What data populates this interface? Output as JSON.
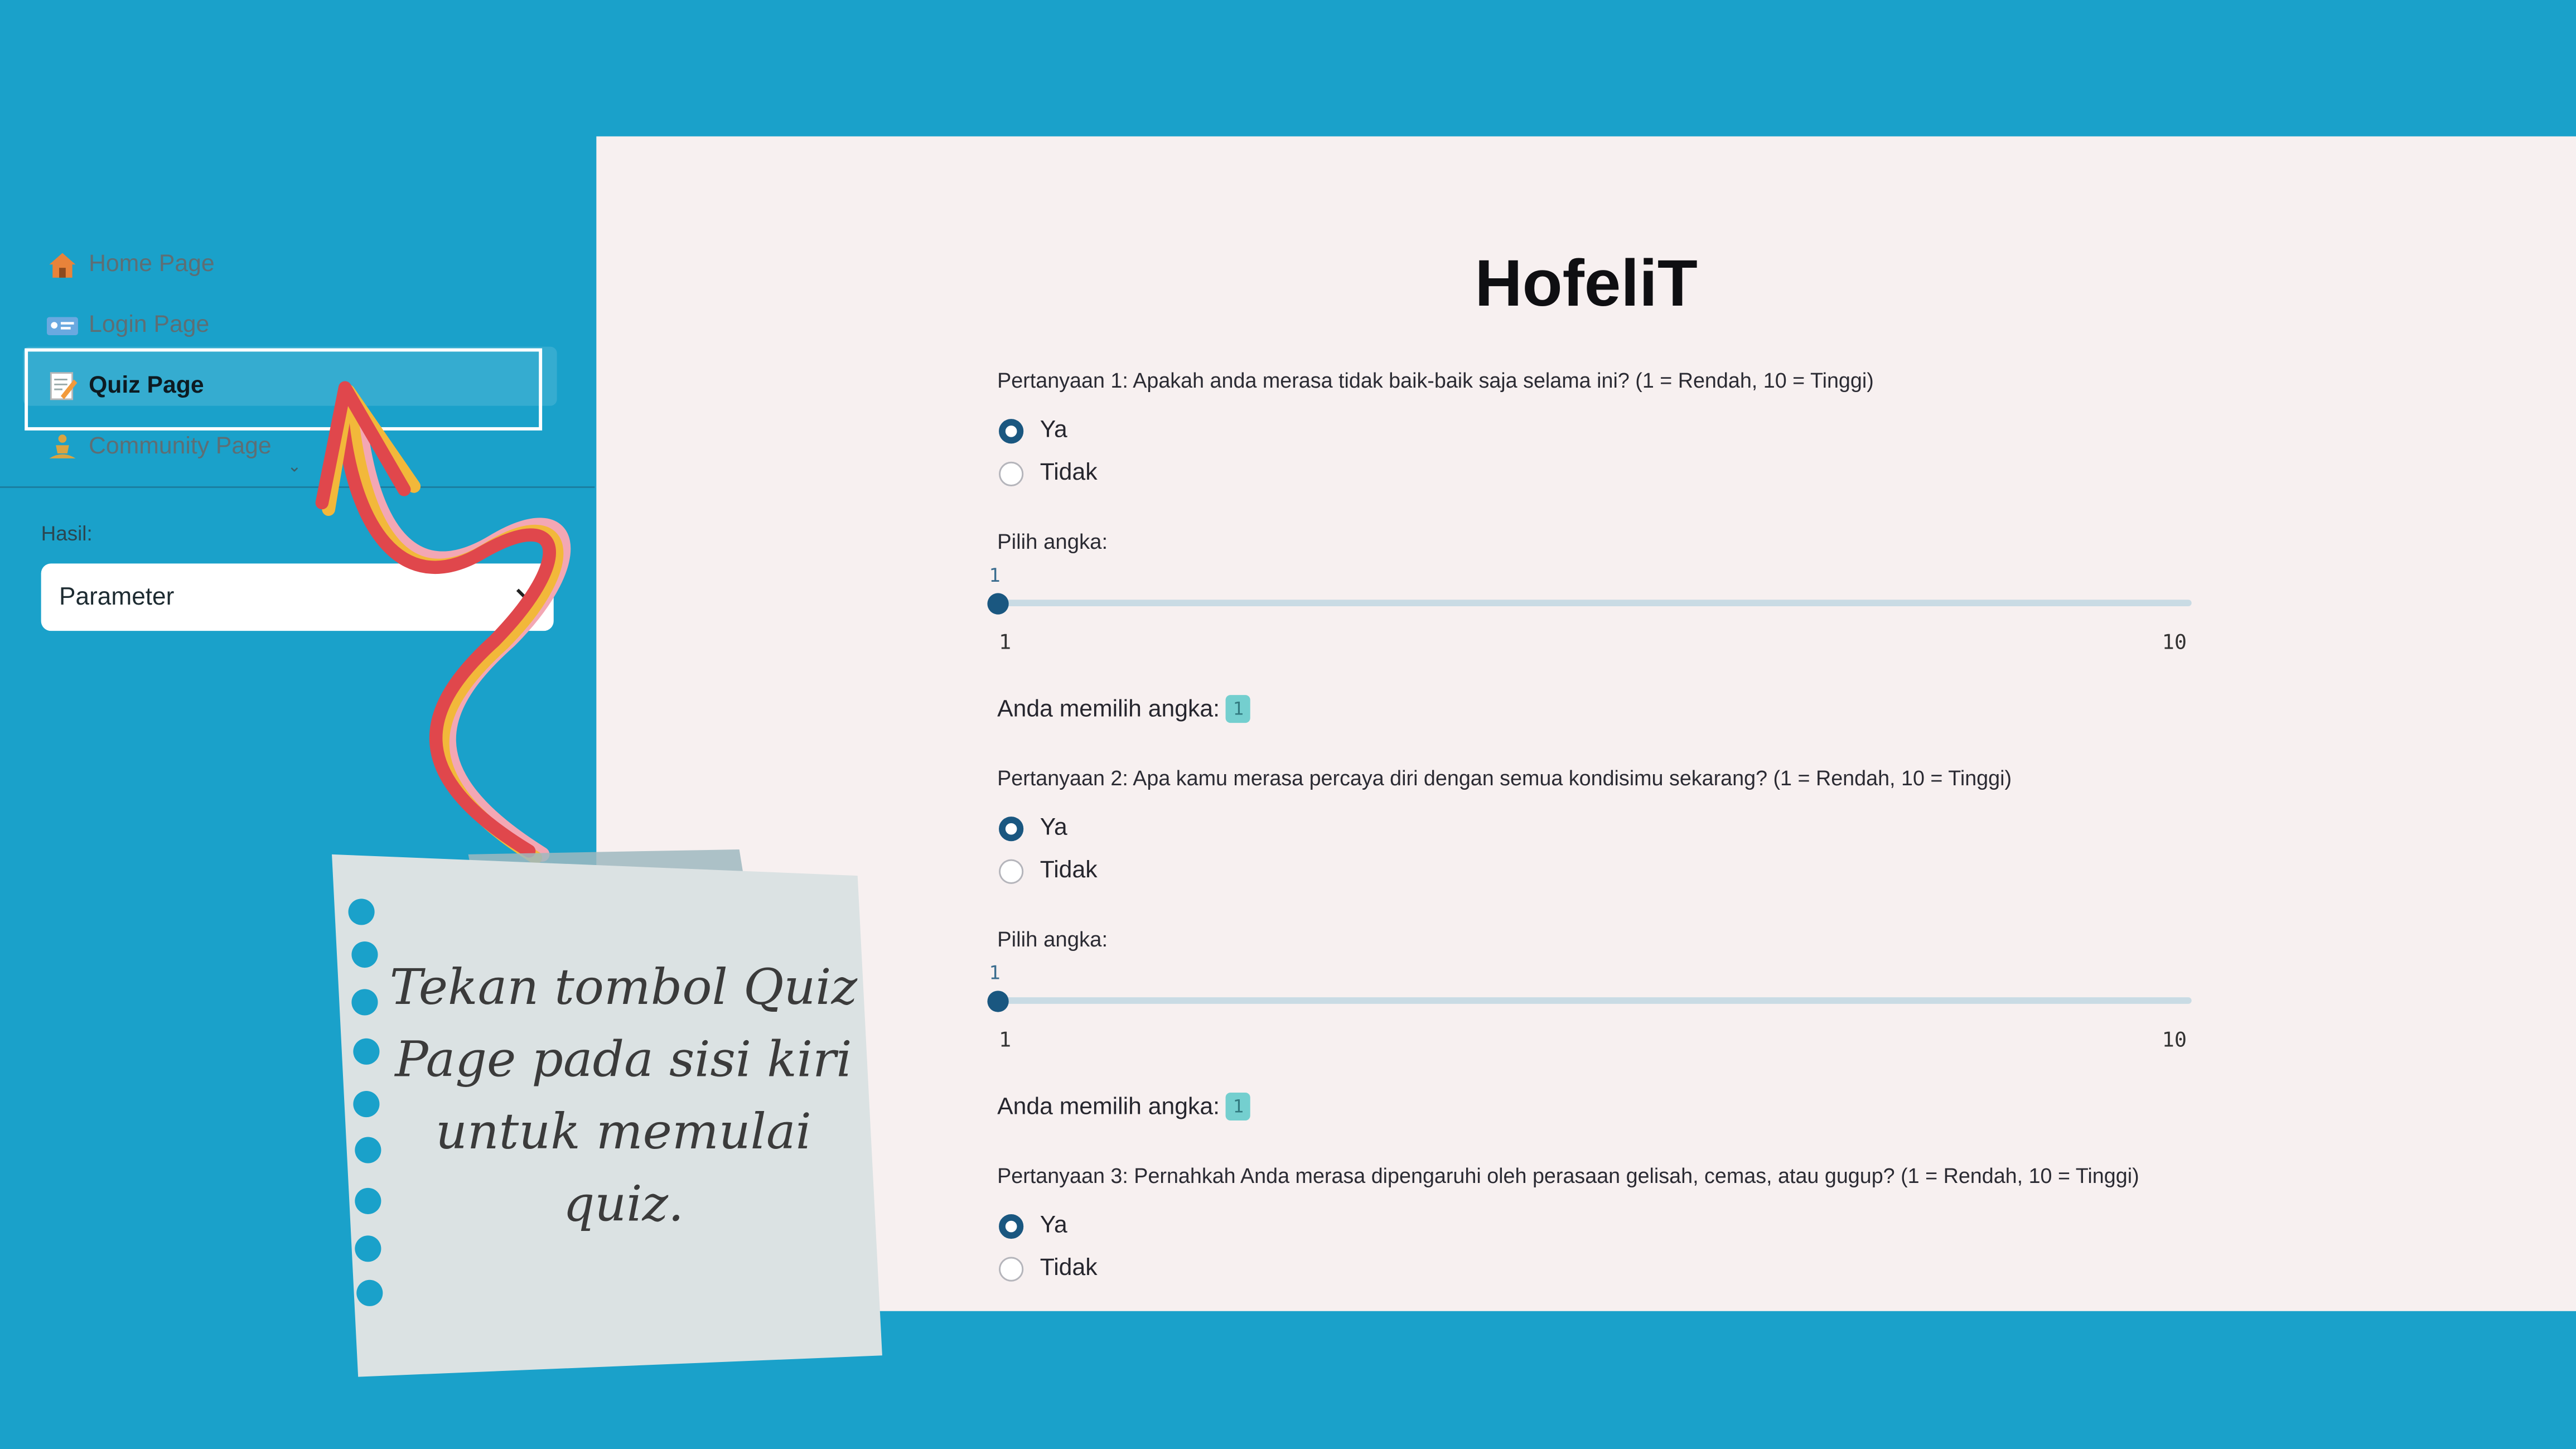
{
  "sidebar": {
    "items": [
      {
        "label": "Home Page",
        "icon": "house-icon"
      },
      {
        "label": "Login Page",
        "icon": "id-card-icon"
      },
      {
        "label": "Quiz Page",
        "icon": "memo-icon",
        "active": true
      },
      {
        "label": "Community Page",
        "icon": "person-meditating-icon"
      }
    ],
    "hasil_label": "Hasil:",
    "select_value": "Parameter"
  },
  "main": {
    "title": "HofeliT",
    "questions": [
      {
        "text": "Pertanyaan 1: Apakah anda merasa tidak baik-baik saja selama ini? (1 = Rendah, 10 = Tinggi)",
        "options": [
          "Ya",
          "Tidak"
        ],
        "selected": "Ya",
        "slider_label": "Pilih angka:",
        "slider_value": "1",
        "slider_min": "1",
        "slider_max": "10",
        "result_label": "Anda memilih angka:",
        "result_value": "1"
      },
      {
        "text": "Pertanyaan 2: Apa kamu merasa percaya diri dengan semua kondisimu sekarang? (1 = Rendah, 10 = Tinggi)",
        "options": [
          "Ya",
          "Tidak"
        ],
        "selected": "Ya",
        "slider_label": "Pilih angka:",
        "slider_value": "1",
        "slider_min": "1",
        "slider_max": "10",
        "result_label": "Anda memilih angka:",
        "result_value": "1"
      },
      {
        "text": "Pertanyaan 3: Pernahkah Anda merasa dipengaruhi oleh perasaan gelisah, cemas, atau gugup? (1 = Rendah, 10 = Tinggi)",
        "options": [
          "Ya",
          "Tidak"
        ],
        "selected": "Ya"
      }
    ]
  },
  "annotation": {
    "note_text": "Tekan tombol Quiz Page pada sisi kiri untuk memulai quiz."
  },
  "colors": {
    "background": "#1aa1ca",
    "content_bg": "#f7f0f0",
    "accent": "#1a5780",
    "arrow_red": "#e0474c",
    "arrow_yellow": "#f2b83a",
    "arrow_pink": "#f3a7b4",
    "note_paper": "#dbe2e3",
    "note_dots": "#1aa1ca"
  }
}
